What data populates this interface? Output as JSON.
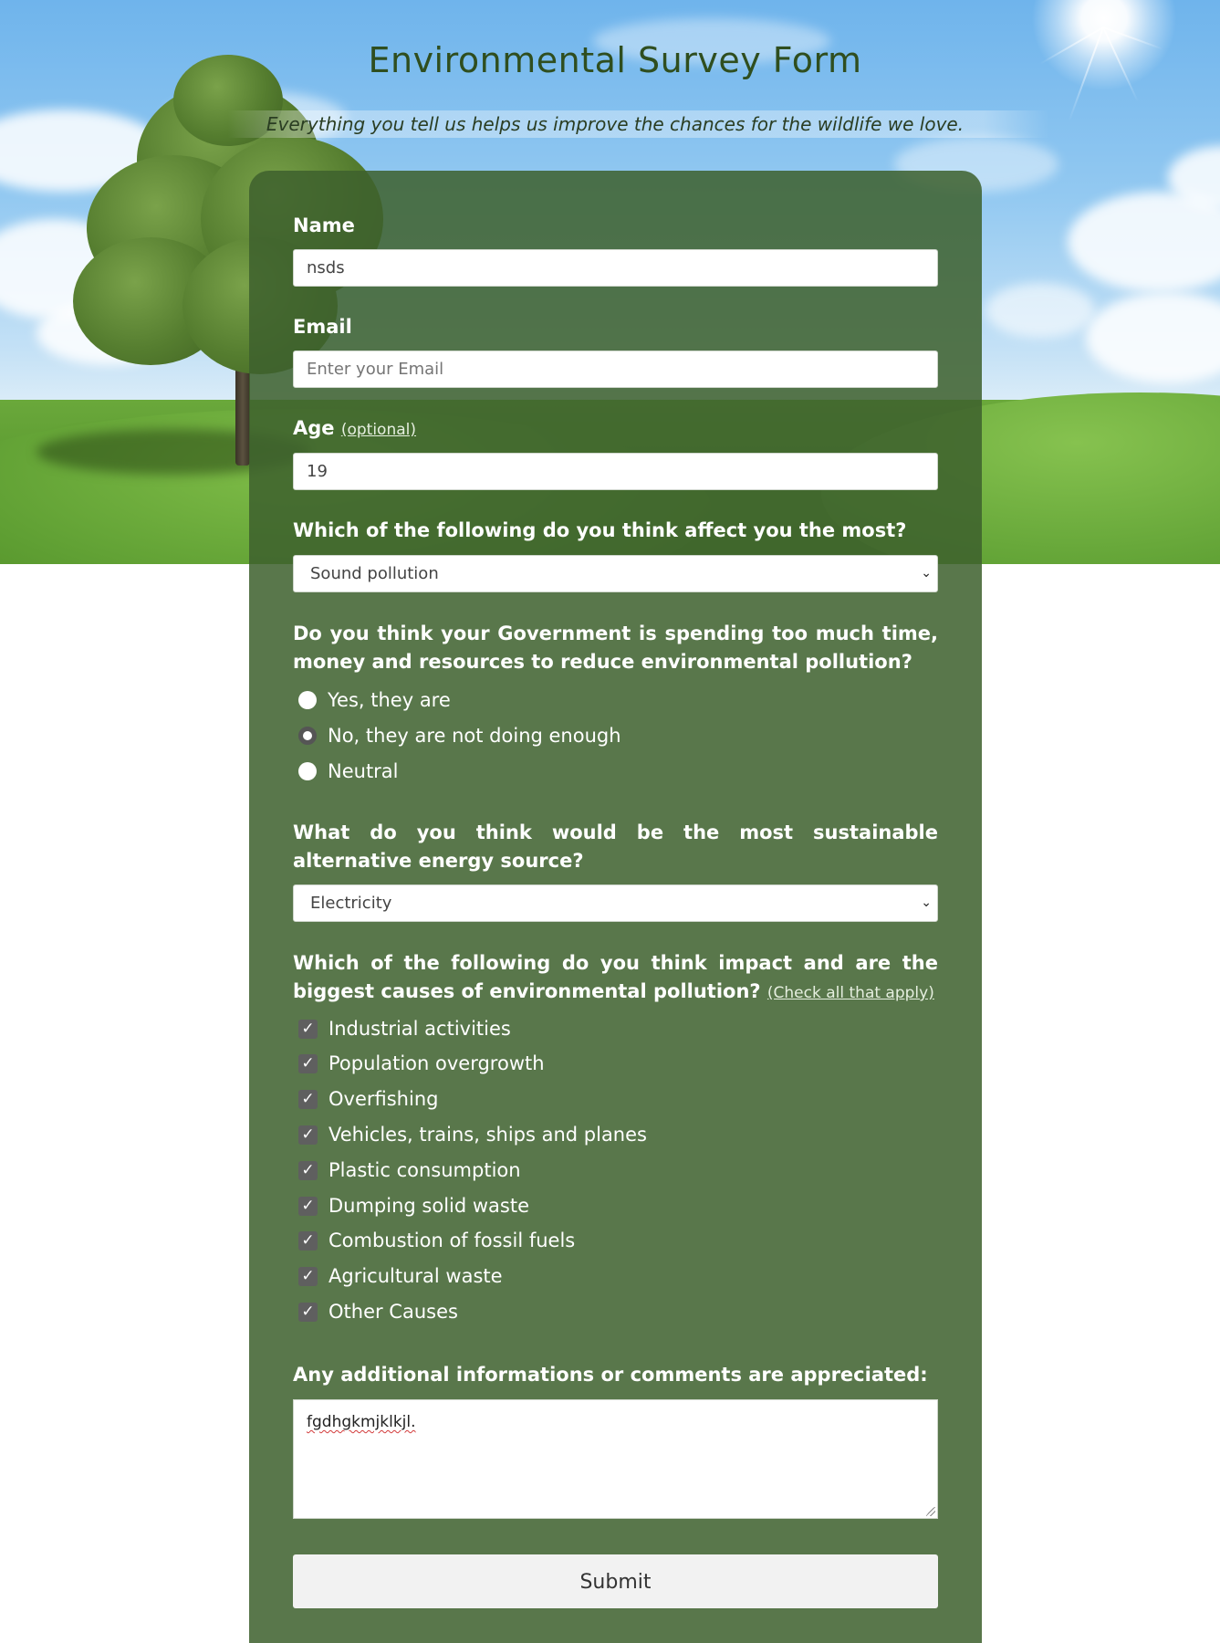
{
  "header": {
    "title": "Environmental Survey Form",
    "subtitle": "Everything you tell us helps us improve the chances for the wildlife we love."
  },
  "form": {
    "name": {
      "label": "Name",
      "value": "nsds"
    },
    "email": {
      "label": "Email",
      "value": "",
      "placeholder": "Enter your Email"
    },
    "age": {
      "label": "Age",
      "hint": "(optional)",
      "value": "19"
    },
    "affect_question": {
      "label": "Which of the following do you think affect you the most?",
      "selected": "Sound pollution"
    },
    "government_question": {
      "label": "Do you think your Government is spending too much time, money and resources to reduce environmental pollution?",
      "options": [
        {
          "label": "Yes, they are",
          "selected": false
        },
        {
          "label": "No, they are not doing enough",
          "selected": true
        },
        {
          "label": "Neutral",
          "selected": false
        }
      ]
    },
    "energy_question": {
      "label": "What do you think would be the most sustainable alternative energy source?",
      "selected": "Electricity"
    },
    "causes_question": {
      "label": "Which of the following do you think impact and are the biggest causes of environmental pollution?",
      "hint": "(Check all that apply)",
      "options": [
        {
          "label": "Industrial activities",
          "checked": true
        },
        {
          "label": "Population overgrowth",
          "checked": true
        },
        {
          "label": "Overfishing",
          "checked": true
        },
        {
          "label": "Vehicles, trains, ships and planes",
          "checked": true
        },
        {
          "label": "Plastic consumption",
          "checked": true
        },
        {
          "label": "Dumping solid waste",
          "checked": true
        },
        {
          "label": "Combustion of fossil fuels",
          "checked": true
        },
        {
          "label": "Agricultural waste",
          "checked": true
        },
        {
          "label": "Other Causes",
          "checked": true
        }
      ]
    },
    "comments": {
      "label": "Any additional informations or comments are appreciated:",
      "value": "fgdhgkmjklkjl."
    },
    "submit_label": "Submit"
  },
  "colors": {
    "card": "#3e612d",
    "title": "#2f4e1f",
    "checkbox": "#5f5f5f"
  },
  "icons": {
    "select_arrow": "chevron-down-icon",
    "checkmark": "check-icon"
  }
}
